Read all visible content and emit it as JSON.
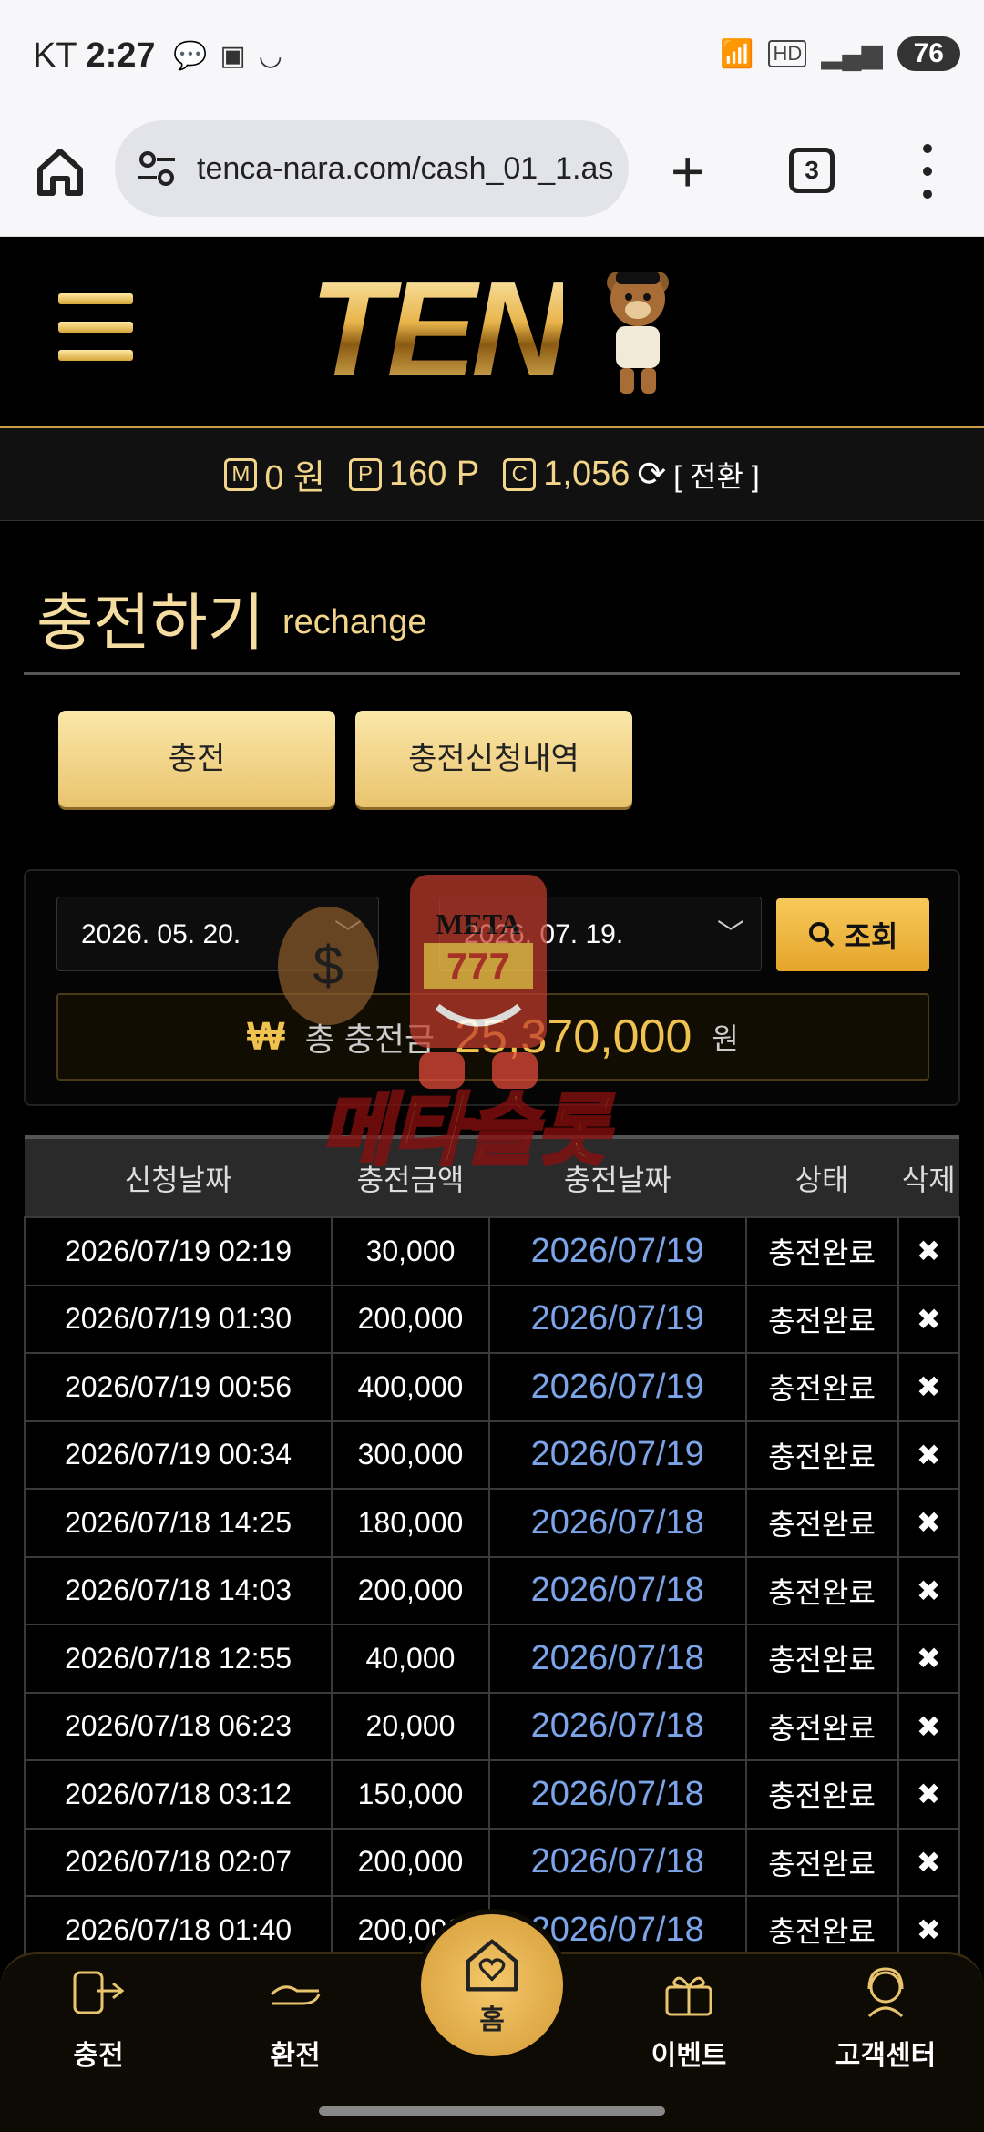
{
  "status_bar": {
    "carrier": "KT",
    "time": "2:27",
    "battery": "76"
  },
  "browser": {
    "url": "tenca-nara.com/cash_01_1.as",
    "tab_count": "3"
  },
  "header": {
    "logo": "TEN"
  },
  "balance": {
    "money_icon": "M",
    "money": "0 원",
    "point_icon": "P",
    "points": "160 P",
    "coin_icon": "C",
    "coins": "1,056",
    "switch_label": "[ 전환 ]"
  },
  "page": {
    "title": "충전하기",
    "subtitle": "rechange"
  },
  "buttons": {
    "charge": "충전",
    "history": "충전신청내역"
  },
  "filter": {
    "date_from": "2026. 05. 20.",
    "date_to": "2026. 07. 19.",
    "search_label": "조회",
    "total_symbol": "₩",
    "total_label": "총 충전금",
    "total_amount": "25,370,000",
    "total_unit": "원"
  },
  "watermark": {
    "top_text": "META",
    "bottom_text": "메타슬롯"
  },
  "table": {
    "headers": [
      "신청날짜",
      "충전금액",
      "충전날짜",
      "상태",
      "삭제"
    ],
    "rows": [
      {
        "requested": "2026/07/19 02:19",
        "amount": "30,000",
        "charged": "2026/07/19",
        "status": "충전완료",
        "delete": "✖"
      },
      {
        "requested": "2026/07/19 01:30",
        "amount": "200,000",
        "charged": "2026/07/19",
        "status": "충전완료",
        "delete": "✖"
      },
      {
        "requested": "2026/07/19 00:56",
        "amount": "400,000",
        "charged": "2026/07/19",
        "status": "충전완료",
        "delete": "✖"
      },
      {
        "requested": "2026/07/19 00:34",
        "amount": "300,000",
        "charged": "2026/07/19",
        "status": "충전완료",
        "delete": "✖"
      },
      {
        "requested": "2026/07/18 14:25",
        "amount": "180,000",
        "charged": "2026/07/18",
        "status": "충전완료",
        "delete": "✖"
      },
      {
        "requested": "2026/07/18 14:03",
        "amount": "200,000",
        "charged": "2026/07/18",
        "status": "충전완료",
        "delete": "✖"
      },
      {
        "requested": "2026/07/18 12:55",
        "amount": "40,000",
        "charged": "2026/07/18",
        "status": "충전완료",
        "delete": "✖"
      },
      {
        "requested": "2026/07/18 06:23",
        "amount": "20,000",
        "charged": "2026/07/18",
        "status": "충전완료",
        "delete": "✖"
      },
      {
        "requested": "2026/07/18 03:12",
        "amount": "150,000",
        "charged": "2026/07/18",
        "status": "충전완료",
        "delete": "✖"
      },
      {
        "requested": "2026/07/18 02:07",
        "amount": "200,000",
        "charged": "2026/07/18",
        "status": "충전완료",
        "delete": "✖"
      },
      {
        "requested": "2026/07/18 01:40",
        "amount": "200,000",
        "charged": "2026/07/18",
        "status": "충전완료",
        "delete": "✖"
      }
    ]
  },
  "bottom_nav": {
    "charge": "충전",
    "exchange": "환전",
    "home": "홈",
    "event": "이벤트",
    "support": "고객센터"
  },
  "colors": {
    "accent_gold": "#f2d58a",
    "link_blue": "#7ba5e8",
    "background": "#000000"
  }
}
